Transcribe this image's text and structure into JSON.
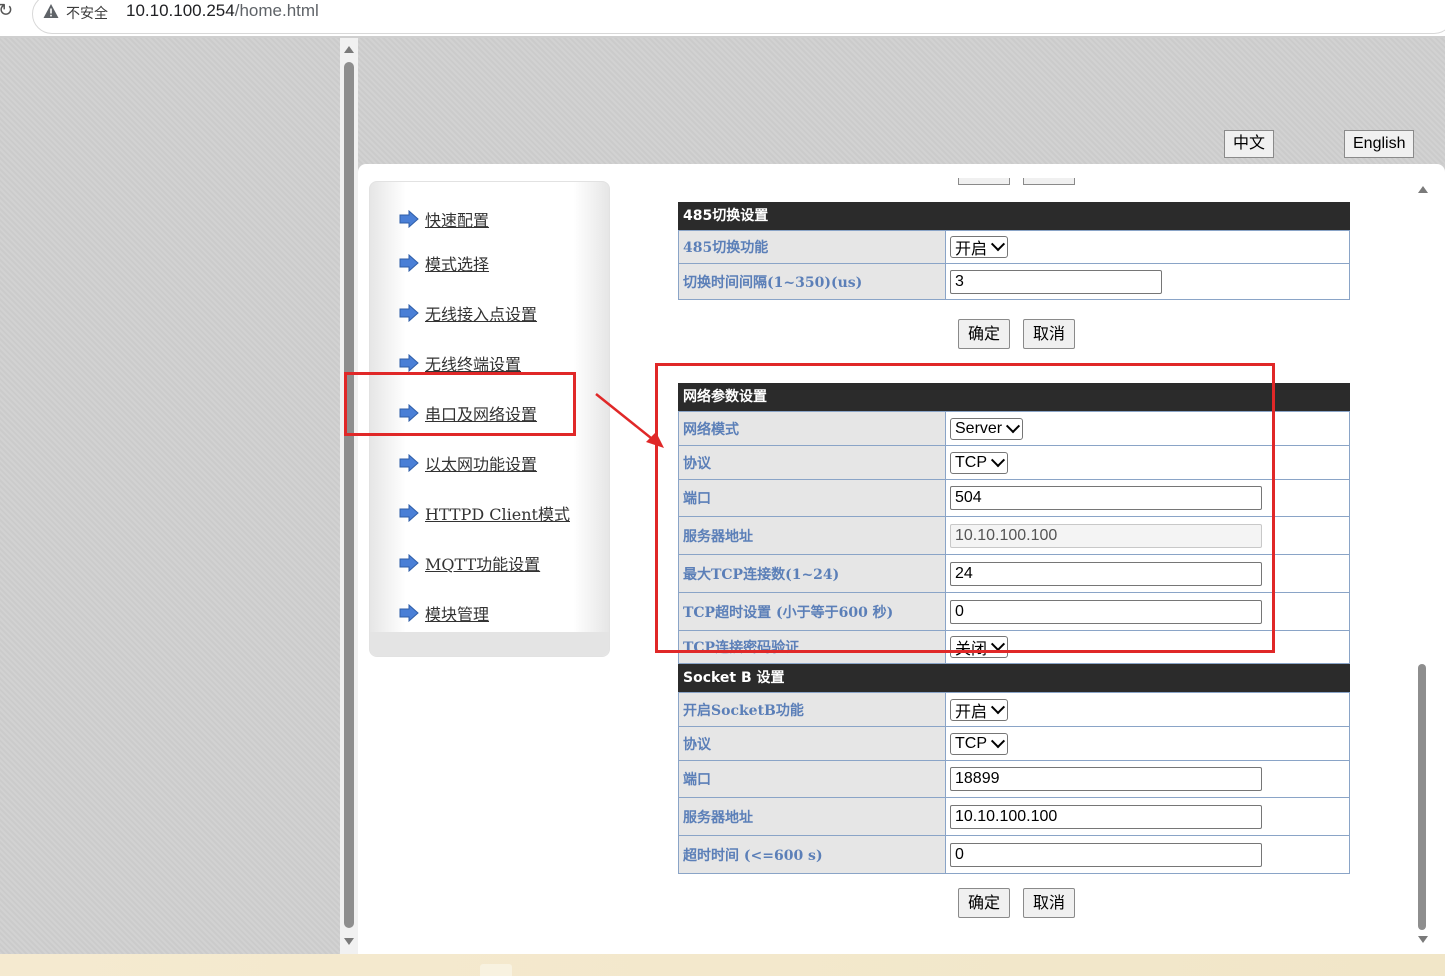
{
  "browser": {
    "security_label": "不安全",
    "url_host": "10.10.100.254",
    "url_path": "/home.html"
  },
  "lang": {
    "zh": "中文",
    "en": "English"
  },
  "menu": {
    "items": [
      {
        "label": "快速配置"
      },
      {
        "label": "模式选择"
      },
      {
        "label": "无线接入点设置"
      },
      {
        "label": "无线终端设置"
      },
      {
        "label": "串口及网络设置"
      },
      {
        "label": "以太网功能设置"
      },
      {
        "label": "HTTPD Client模式"
      },
      {
        "label": "MQTT功能设置"
      },
      {
        "label": "模块管理"
      }
    ]
  },
  "section_485": {
    "title": "485切换设置",
    "switch_label": "485切换功能",
    "switch_value": "开启",
    "interval_label": "切换时间间隔(1~350)(us)",
    "interval_value": "3",
    "ok": "确定",
    "cancel": "取消"
  },
  "section_net": {
    "title": "网络参数设置",
    "mode_label": "网络模式",
    "mode_value": "Server",
    "proto_label": "协议",
    "proto_value": "TCP",
    "port_label": "端口",
    "port_value": "504",
    "server_label": "服务器地址",
    "server_value": "10.10.100.100",
    "maxconn_label": "最大TCP连接数(1~24)",
    "maxconn_value": "24",
    "timeout_label": "TCP超时设置 (小于等于600 秒)",
    "timeout_value": "0",
    "pwd_label": "TCP连接密码验证",
    "pwd_value": "关闭"
  },
  "section_sockb": {
    "title": "Socket B 设置",
    "enable_label": "开启SocketB功能",
    "enable_value": "开启",
    "proto_label": "协议",
    "proto_value": "TCP",
    "port_label": "端口",
    "port_value": "18899",
    "server_label": "服务器地址",
    "server_value": "10.10.100.100",
    "timeout_label": "超时时间 (<=600 s)",
    "timeout_value": "0",
    "ok": "确定",
    "cancel": "取消"
  },
  "colors": {
    "annotation": "#e02828",
    "label_text": "#5b7fb8",
    "header_bg": "#2b2b2b"
  }
}
